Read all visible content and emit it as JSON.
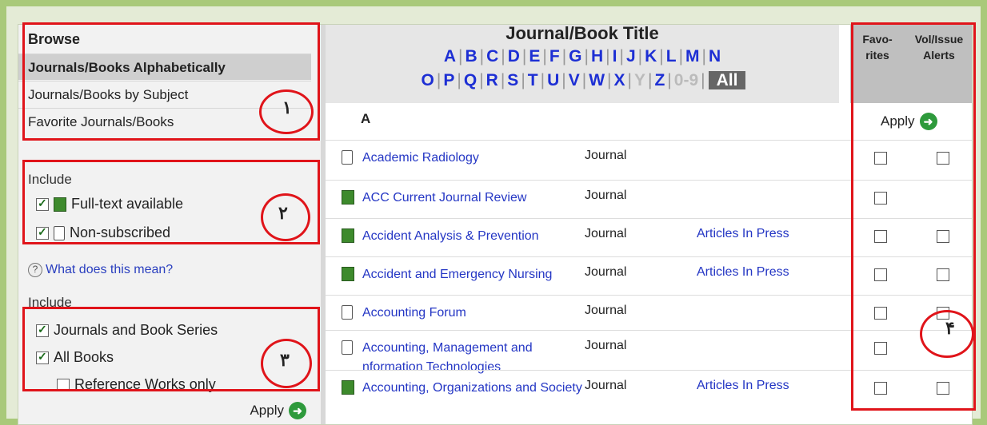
{
  "sidebar": {
    "browse_title": "Browse",
    "links": [
      {
        "label": "Journals/Books Alphabetically",
        "active": true
      },
      {
        "label": "Journals/Books by Subject",
        "active": false
      },
      {
        "label": "Favorite Journals/Books",
        "active": false
      }
    ],
    "include1_title": "Include",
    "include1_options": [
      {
        "label": "Full-text available",
        "checked": true,
        "icon": "full-text-green-icon"
      },
      {
        "label": "Non-subscribed",
        "checked": true,
        "icon": "document-icon"
      }
    ],
    "help_link": "What does this mean?",
    "include2_title": "Include",
    "include2_options": [
      {
        "label": "Journals and Book Series",
        "checked": true
      },
      {
        "label": "All Books",
        "checked": true
      },
      {
        "label": "Reference Works only",
        "checked": false
      }
    ],
    "apply_label": "Apply"
  },
  "header": {
    "title": "Journal/Book Title",
    "letters_row1": [
      "A",
      "B",
      "C",
      "D",
      "E",
      "F",
      "G",
      "H",
      "I",
      "J",
      "K",
      "L",
      "M",
      "N"
    ],
    "letters_row2": [
      "O",
      "P",
      "Q",
      "R",
      "S",
      "T",
      "U",
      "V",
      "W",
      "X",
      "Y",
      "Z",
      "0-9"
    ],
    "disabled_letters": [
      "Y",
      "0-9"
    ],
    "all_label": "All"
  },
  "right_column": {
    "favorites_header": "Favo-\nrites",
    "alerts_header": "Vol/Issue\nAlerts",
    "apply_label": "Apply"
  },
  "letter_heading": "A",
  "rows": [
    {
      "title": "Academic Radiology",
      "type": "Journal",
      "press": "",
      "full_text": false,
      "alert_box": true
    },
    {
      "title": "ACC Current Journal Review",
      "type": "Journal",
      "press": "",
      "full_text": true,
      "alert_box": false
    },
    {
      "title": "Accident Analysis & Prevention",
      "type": "Journal",
      "press": "Articles In Press",
      "full_text": true,
      "alert_box": true
    },
    {
      "title": "Accident and Emergency Nursing",
      "type": "Journal",
      "press": "Articles In Press",
      "full_text": true,
      "alert_box": true
    },
    {
      "title": "Accounting Forum",
      "type": "Journal",
      "press": "",
      "full_text": false,
      "alert_box": true
    },
    {
      "title": "Accounting, Management and nformation Technologies",
      "type": "Journal",
      "press": "",
      "full_text": false,
      "alert_box": false
    },
    {
      "title": "Accounting, Organizations and Society",
      "type": "Journal",
      "press": "Articles In Press",
      "full_text": true,
      "alert_box": true
    }
  ],
  "annotations": {
    "n1": "١",
    "n2": "٢",
    "n3": "٣",
    "n4": "۴"
  },
  "colors": {
    "annotation_red": "#e0141a",
    "link_blue": "#2436c4",
    "full_text_green": "#3d8a2c",
    "page_green": "#a9c97a"
  }
}
